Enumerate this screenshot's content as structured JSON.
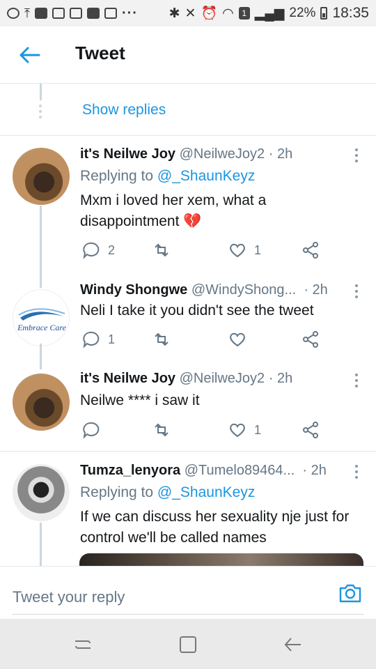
{
  "status_bar": {
    "battery": "22%",
    "time": "18:35",
    "sim_badge": "1"
  },
  "header": {
    "title": "Tweet"
  },
  "thread": {
    "show_replies": "Show replies"
  },
  "tweets": [
    {
      "name": "it's Neilwe Joy",
      "handle": "@NeilweJoy2",
      "time": "2h",
      "replying_prefix": "Replying to",
      "replying_to": "@_ShaunKeyz",
      "text": "Mxm i loved her xem, what a disappointment 💔",
      "replies": "2",
      "retweets": "",
      "likes": "1"
    },
    {
      "name": "Windy Shongwe",
      "handle": "@WindyShong...",
      "time": "2h",
      "text": "Neli I take it you didn't see the tweet",
      "replies": "1",
      "retweets": "",
      "likes": "",
      "avatar_text": "Embrace Care"
    },
    {
      "name": "it's Neilwe Joy",
      "handle": "@NeilweJoy2",
      "time": "2h",
      "text": "Neilwe **** i saw it",
      "replies": "",
      "retweets": "",
      "likes": "1"
    },
    {
      "name": "Tumza_lenyora",
      "handle": "@Tumelo89464...",
      "time": "2h",
      "replying_prefix": "Replying to",
      "replying_to": "@_ShaunKeyz",
      "text": "If we can discuss her sexuality nje just for control we'll be called names"
    }
  ],
  "reply_bar": {
    "placeholder": "Tweet your reply"
  },
  "colors": {
    "accent": "#1b95e0",
    "muted": "#657786",
    "line": "#ccd6dd"
  }
}
